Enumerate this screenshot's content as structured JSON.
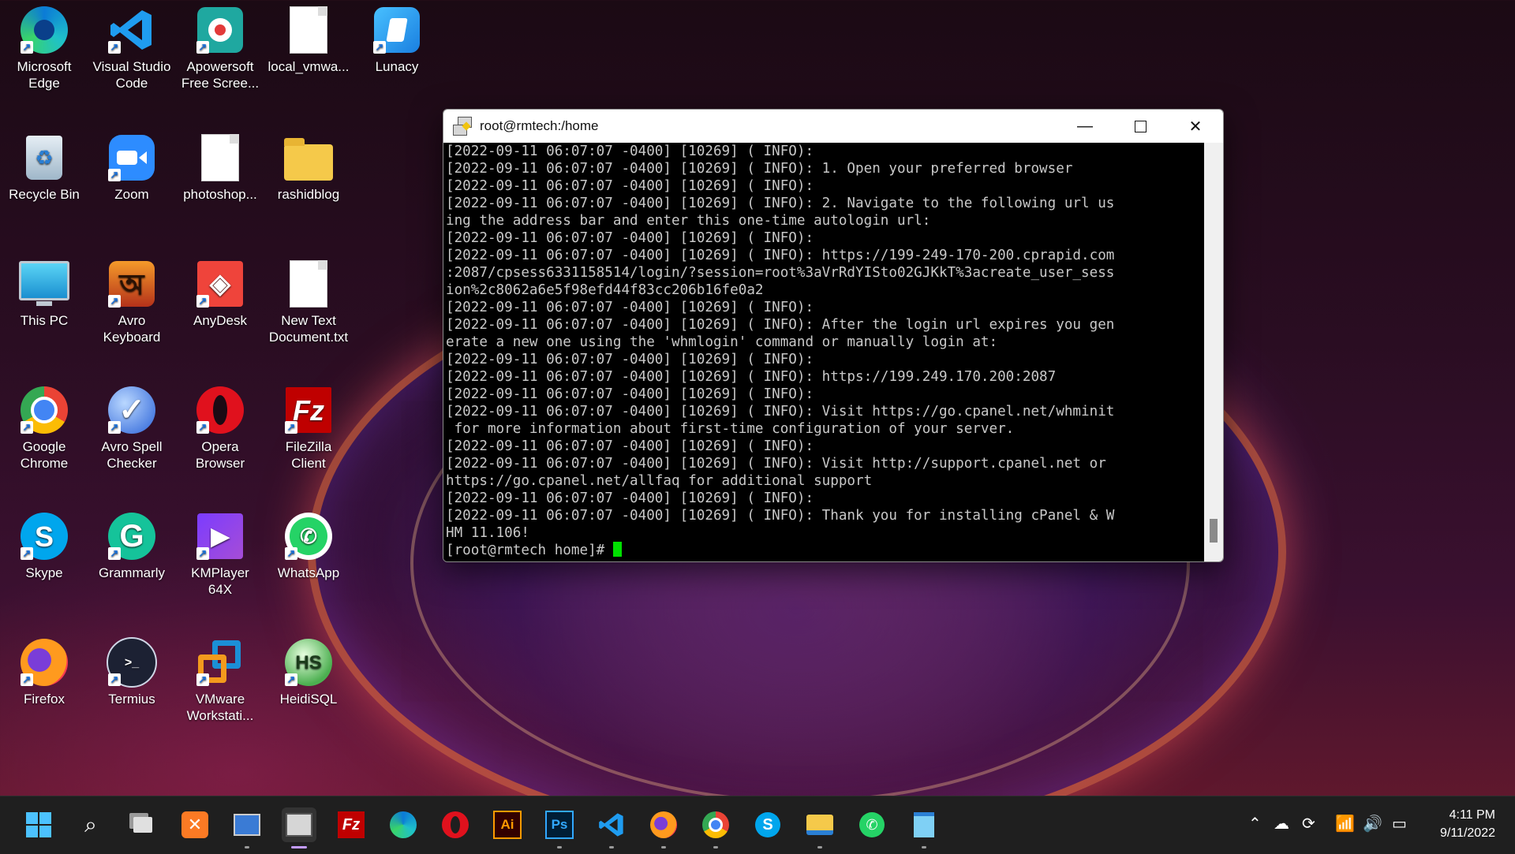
{
  "desktop": {
    "icons": [
      {
        "label": "Microsoft Edge",
        "icon": "edge-icon"
      },
      {
        "label": "Visual Studio Code",
        "icon": "vscode-icon"
      },
      {
        "label": "Apowersoft Free Scree...",
        "icon": "apowersoft-icon"
      },
      {
        "label": "local_vmwa...",
        "icon": "file-icon"
      },
      {
        "label": "Lunacy",
        "icon": "lunacy-icon"
      },
      {
        "label": "Recycle Bin",
        "icon": "recycle-bin-icon"
      },
      {
        "label": "Zoom",
        "icon": "zoom-icon"
      },
      {
        "label": "photoshop...",
        "icon": "file-icon"
      },
      {
        "label": "rashidblog",
        "icon": "folder-icon"
      },
      {
        "label": "This PC",
        "icon": "monitor-icon"
      },
      {
        "label": "Avro Keyboard",
        "icon": "avro-keyboard-icon"
      },
      {
        "label": "AnyDesk",
        "icon": "anydesk-icon"
      },
      {
        "label": "New Text Document.txt",
        "icon": "text-file-icon"
      },
      {
        "label": "Google Chrome",
        "icon": "chrome-icon"
      },
      {
        "label": "Avro Spell Checker",
        "icon": "avro-spell-icon"
      },
      {
        "label": "Opera Browser",
        "icon": "opera-icon"
      },
      {
        "label": "FileZilla Client",
        "icon": "filezilla-icon"
      },
      {
        "label": "Skype",
        "icon": "skype-icon"
      },
      {
        "label": "Grammarly",
        "icon": "grammarly-icon"
      },
      {
        "label": "KMPlayer 64X",
        "icon": "kmplayer-icon"
      },
      {
        "label": "WhatsApp",
        "icon": "whatsapp-icon"
      },
      {
        "label": "Firefox",
        "icon": "firefox-icon"
      },
      {
        "label": "Termius",
        "icon": "termius-icon"
      },
      {
        "label": "VMware Workstati...",
        "icon": "vmware-icon"
      },
      {
        "label": "HeidiSQL",
        "icon": "heidisql-icon"
      }
    ]
  },
  "terminal": {
    "title": "root@rmtech:/home",
    "lines": [
      "[2022-09-11 06:07:07 -0400] [10269] ( INFO):",
      "[2022-09-11 06:07:07 -0400] [10269] ( INFO): 1. Open your preferred browser",
      "[2022-09-11 06:07:07 -0400] [10269] ( INFO):",
      "[2022-09-11 06:07:07 -0400] [10269] ( INFO): 2. Navigate to the following url us",
      "ing the address bar and enter this one-time autologin url:",
      "[2022-09-11 06:07:07 -0400] [10269] ( INFO):",
      "[2022-09-11 06:07:07 -0400] [10269] ( INFO): https://199-249-170-200.cprapid.com",
      ":2087/cpsess6331158514/login/?session=root%3aVrRdYISto02GJKkT%3acreate_user_sess",
      "ion%2c8062a6e5f98efd44f83cc206b16fe0a2",
      "[2022-09-11 06:07:07 -0400] [10269] ( INFO):",
      "[2022-09-11 06:07:07 -0400] [10269] ( INFO): After the login url expires you gen",
      "erate a new one using the 'whmlogin' command or manually login at:",
      "[2022-09-11 06:07:07 -0400] [10269] ( INFO):",
      "[2022-09-11 06:07:07 -0400] [10269] ( INFO): https://199.249.170.200:2087",
      "[2022-09-11 06:07:07 -0400] [10269] ( INFO):",
      "[2022-09-11 06:07:07 -0400] [10269] ( INFO): Visit https://go.cpanel.net/whminit",
      " for more information about first-time configuration of your server.",
      "[2022-09-11 06:07:07 -0400] [10269] ( INFO):",
      "[2022-09-11 06:07:07 -0400] [10269] ( INFO): Visit http://support.cpanel.net or",
      "https://go.cpanel.net/allfaq for additional support",
      "[2022-09-11 06:07:07 -0400] [10269] ( INFO):",
      "[2022-09-11 06:07:07 -0400] [10269] ( INFO): Thank you for installing cPanel & W",
      "HM 11.106!"
    ],
    "prompt": "[root@rmtech home]# "
  },
  "taskbar": {
    "apps": [
      "start-icon",
      "search-icon",
      "task-view-icon",
      "xampp-icon",
      "remote-desktop-icon",
      "putty-icon",
      "filezilla-icon",
      "edge-icon",
      "opera-icon",
      "illustrator-icon",
      "photoshop-icon",
      "vscode-icon",
      "firefox-icon",
      "chrome-icon",
      "skype-icon",
      "file-explorer-icon",
      "whatsapp-icon",
      "notepad-icon"
    ],
    "illustrator_label": "Ai",
    "photoshop_label": "Ps",
    "time": "4:11 PM",
    "date": "9/11/2022"
  },
  "colors": {
    "cursor": "#00e000",
    "terminal_bg": "#000000",
    "terminal_fg": "#c8c8c8",
    "taskbar_bg": "#1f1f1f"
  }
}
